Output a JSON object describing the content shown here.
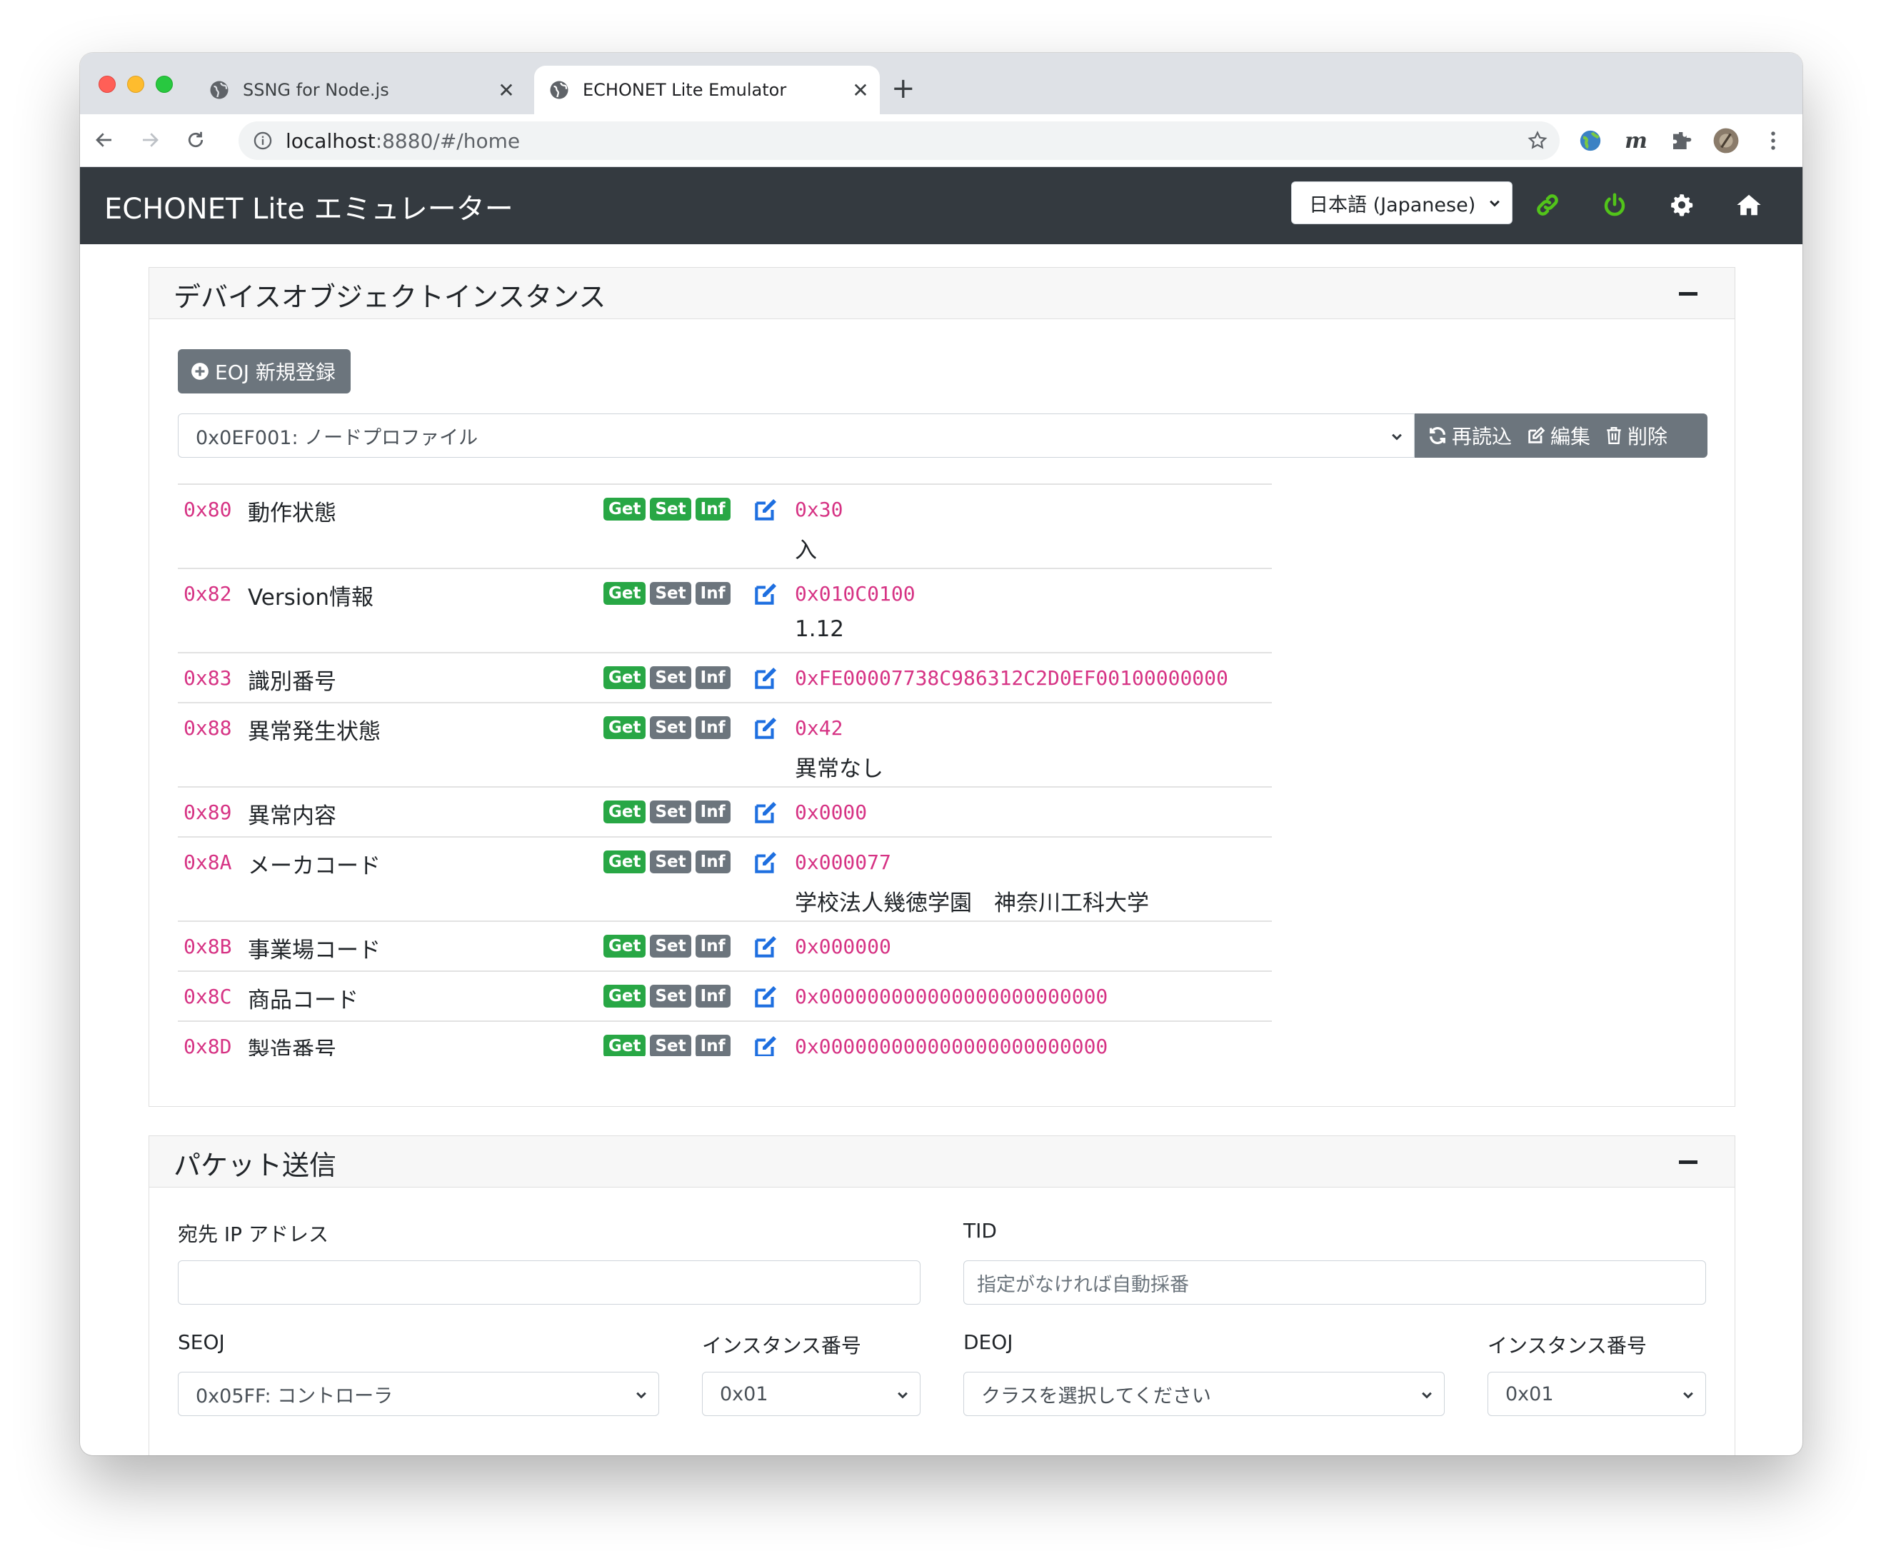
{
  "browser": {
    "tabs": [
      {
        "title": "SSNG for Node.js",
        "close": "✕"
      },
      {
        "title": "ECHONET Lite Emulator",
        "close": "✕"
      }
    ],
    "new_tab": "+",
    "url_host": "localhost",
    "url_rest": ":8880/#/home"
  },
  "navbar": {
    "brand": "ECHONET Lite エミュレーター",
    "language": "日本語 (Japanese)",
    "accent_green": "#52c41a"
  },
  "devices": {
    "title": "デバイスオブジェクトインスタンス",
    "add_button": "EOJ 新規登録",
    "selected_eoj": "0x0EF001: ノードプロファイル",
    "reload": "再読込",
    "edit": "編集",
    "delete": "削除",
    "properties": [
      {
        "epc": "0x80",
        "name": "動作状態",
        "get": true,
        "set": true,
        "inf": true,
        "value": "0x30",
        "desc": "入"
      },
      {
        "epc": "0x82",
        "name": "Version情報",
        "get": true,
        "set": false,
        "inf": false,
        "value": "0x010C0100",
        "desc": "1.12"
      },
      {
        "epc": "0x83",
        "name": "識別番号",
        "get": true,
        "set": false,
        "inf": false,
        "value": "0xFE00007738C986312C2D0EF00100000000",
        "desc": ""
      },
      {
        "epc": "0x88",
        "name": "異常発生状態",
        "get": true,
        "set": false,
        "inf": false,
        "value": "0x42",
        "desc": "異常なし"
      },
      {
        "epc": "0x89",
        "name": "異常内容",
        "get": true,
        "set": false,
        "inf": false,
        "value": "0x0000",
        "desc": ""
      },
      {
        "epc": "0x8A",
        "name": "メーカコード",
        "get": true,
        "set": false,
        "inf": false,
        "value": "0x000077",
        "desc": "学校法人幾徳学園　神奈川工科大学"
      },
      {
        "epc": "0x8B",
        "name": "事業場コード",
        "get": true,
        "set": false,
        "inf": false,
        "value": "0x000000",
        "desc": ""
      },
      {
        "epc": "0x8C",
        "name": "商品コード",
        "get": true,
        "set": false,
        "inf": false,
        "value": "0x000000000000000000000000",
        "desc": ""
      },
      {
        "epc": "0x8D",
        "name": "製造番号",
        "get": true,
        "set": false,
        "inf": false,
        "value": "0x000000000000000000000000",
        "desc": ""
      }
    ],
    "badge_labels": {
      "get": "Get",
      "set": "Set",
      "inf": "Inf"
    }
  },
  "packet": {
    "title": "パケット送信",
    "dest_ip_label": "宛先 IP アドレス",
    "dest_ip_value": "",
    "tid_label": "TID",
    "tid_placeholder": "指定がなければ自動採番",
    "seoj_label": "SEOJ",
    "seoj_value": "0x05FF: コントローラ",
    "seoj_instance_label": "インスタンス番号",
    "seoj_instance_value": "0x01",
    "deoj_label": "DEOJ",
    "deoj_value": "クラスを選択してください",
    "deoj_instance_label": "インスタンス番号",
    "deoj_instance_value": "0x01"
  }
}
